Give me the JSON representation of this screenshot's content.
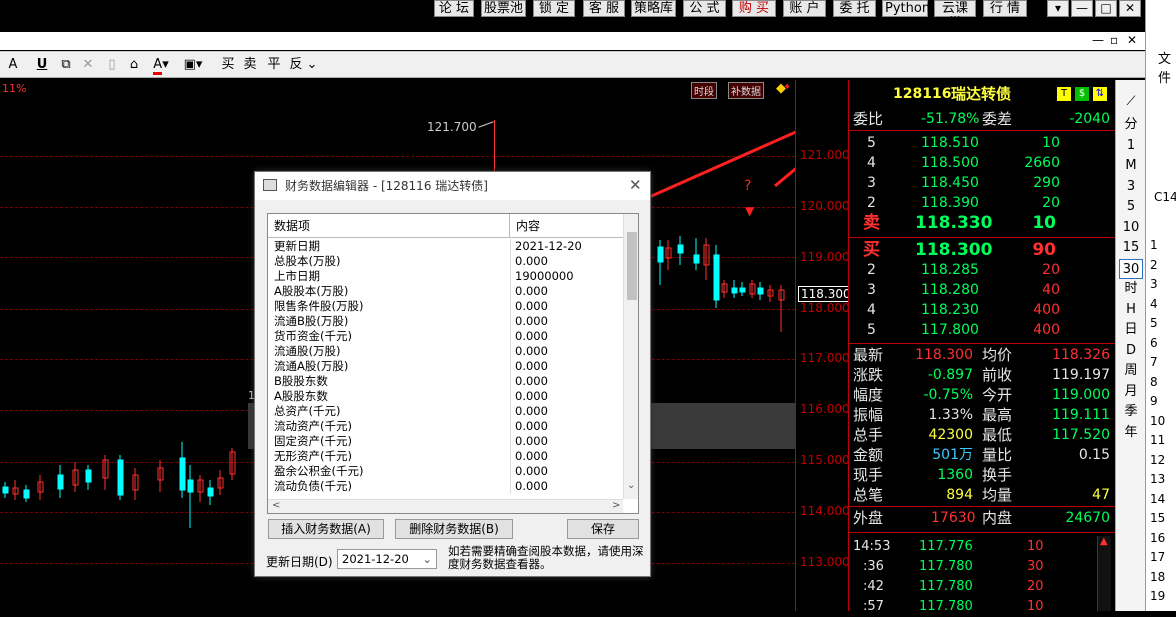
{
  "menu": [
    "论 坛",
    "股票池",
    "锁 定",
    "客 服",
    "策略库",
    "公 式",
    "购 买",
    "账 户",
    "委 托",
    "Python",
    "云课堂",
    "行 情"
  ],
  "menu_red_index": 6,
  "window_controls": [
    "▾",
    "—",
    "□",
    "✕"
  ],
  "inner_controls": [
    "—",
    "▫",
    "✕"
  ],
  "toolbar": {
    "a": "A",
    "u": "U",
    "b1": "买",
    "b2": "卖",
    "b3": "平",
    "b4": "反",
    "more": "⌄"
  },
  "chart": {
    "pct_label": "11%",
    "peak_label": "121.700",
    "tags": [
      "时段",
      "补数据"
    ],
    "yticks": [
      "121.000",
      "120.000",
      "119.000",
      "118.000",
      "117.000",
      "116.000",
      "115.000",
      "114.000",
      "113.000"
    ],
    "hidden_tick": "1",
    "price_tag": "118.300"
  },
  "quote": {
    "code": "128116",
    "name": "瑞达转债",
    "icons": [
      "T",
      "$",
      "⇅"
    ],
    "weibi_label": "委比",
    "weibi": "-51.78%",
    "weicha_label": "委差",
    "weicha": "-2040",
    "asks": [
      {
        "lvl": "5",
        "price": "118.510",
        "vol": "10"
      },
      {
        "lvl": "4",
        "price": "118.500",
        "vol": "2660"
      },
      {
        "lvl": "3",
        "price": "118.450",
        "vol": "290"
      },
      {
        "lvl": "2",
        "price": "118.390",
        "vol": "20"
      },
      {
        "lvl": "卖",
        "price": "118.330",
        "vol": "10"
      }
    ],
    "bids": [
      {
        "lvl": "买",
        "price": "118.300",
        "vol": "90"
      },
      {
        "lvl": "2",
        "price": "118.285",
        "vol": "20"
      },
      {
        "lvl": "3",
        "price": "118.280",
        "vol": "40"
      },
      {
        "lvl": "4",
        "price": "118.230",
        "vol": "400"
      },
      {
        "lvl": "5",
        "price": "117.800",
        "vol": "400"
      }
    ],
    "stats": [
      {
        "l1": "最新",
        "v1": "118.300",
        "c1": "r",
        "l2": "均价",
        "v2": "118.326",
        "c2": "r"
      },
      {
        "l1": "涨跌",
        "v1": "-0.897",
        "c1": "g",
        "l2": "前收",
        "v2": "119.197",
        "c2": "w"
      },
      {
        "l1": "幅度",
        "v1": "-0.75%",
        "c1": "g",
        "l2": "今开",
        "v2": "119.000",
        "c2": "g"
      },
      {
        "l1": "振幅",
        "v1": "1.33%",
        "c1": "w",
        "l2": "最高",
        "v2": "119.111",
        "c2": "g"
      },
      {
        "l1": "总手",
        "v1": "42300",
        "c1": "y",
        "l2": "最低",
        "v2": "117.520",
        "c2": "g"
      },
      {
        "l1": "金额",
        "v1": "501万",
        "c1": "c",
        "l2": "量比",
        "v2": "0.15",
        "c2": "w"
      },
      {
        "l1": "现手",
        "v1": "1360",
        "c1": "g",
        "l2": "换手",
        "v2": "",
        "c2": "w"
      },
      {
        "l1": "总笔",
        "v1": "894",
        "c1": "y",
        "l2": "均量",
        "v2": "47",
        "c2": "y"
      }
    ],
    "waipan_label": "外盘",
    "waipan": "17630",
    "neipan_label": "内盘",
    "neipan": "24670",
    "ticks": [
      {
        "t": "14:53",
        "p": "117.776",
        "v": "10"
      },
      {
        "t": ":36",
        "p": "117.780",
        "v": "30"
      },
      {
        "t": ":42",
        "p": "117.780",
        "v": "20"
      },
      {
        "t": ":57",
        "p": "117.780",
        "v": "10"
      }
    ]
  },
  "rail": [
    "分",
    "1",
    "M",
    "3",
    "5",
    "10",
    "15",
    "30",
    "时",
    "H",
    "日",
    "D",
    "周",
    "月",
    "季",
    "年"
  ],
  "excel": {
    "file": "文件",
    "cell": "C14",
    "rows": [
      "1",
      "2",
      "3",
      "4",
      "5",
      "6",
      "7",
      "8",
      "9",
      "10",
      "11",
      "12",
      "13",
      "14",
      "15",
      "16",
      "17",
      "18",
      "19"
    ]
  },
  "dialog": {
    "title": "财务数据编辑器 - [128116 瑞达转债]",
    "col1": "数据项",
    "col2": "内容",
    "rows": [
      [
        "更新日期",
        "2021-12-20"
      ],
      [
        "总股本(万股)",
        "0.000"
      ],
      [
        "上市日期",
        "19000000"
      ],
      [
        "A股股本(万股)",
        "0.000"
      ],
      [
        "限售条件股(万股)",
        "0.000"
      ],
      [
        "流通B股(万股)",
        "0.000"
      ],
      [
        "货币资金(千元)",
        "0.000"
      ],
      [
        "流通股(万股)",
        "0.000"
      ],
      [
        "流通A股(万股)",
        "0.000"
      ],
      [
        "B股股东数",
        "0.000"
      ],
      [
        "A股股东数",
        "0.000"
      ],
      [
        "总资产(千元)",
        "0.000"
      ],
      [
        "流动资产(千元)",
        "0.000"
      ],
      [
        "固定资产(千元)",
        "0.000"
      ],
      [
        "无形资产(千元)",
        "0.000"
      ],
      [
        "盈余公积金(千元)",
        "0.000"
      ],
      [
        "流动负债(千元)",
        "0.000"
      ]
    ],
    "btn_insert": "插入财务数据(A)",
    "btn_delete": "删除财务数据(B)",
    "btn_save": "保存",
    "date_label": "更新日期(D)",
    "date_value": "2021-12-20",
    "hint": "如若需要精确查阅股本数据，请使用深度财务数据查看器。"
  },
  "annotation": "?"
}
